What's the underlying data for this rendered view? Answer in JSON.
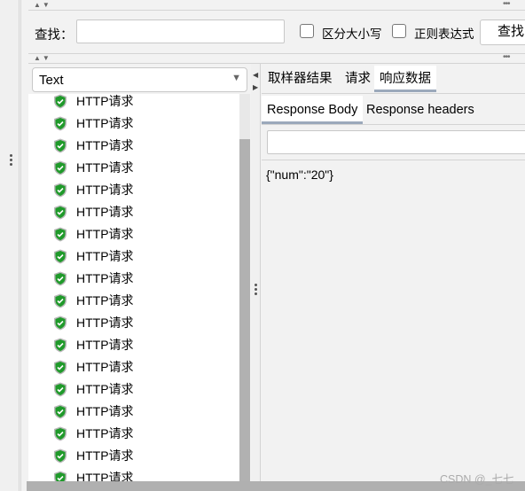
{
  "search": {
    "label": "查找：",
    "value": "",
    "case_label": "区分大小写",
    "regex_label": "正则表达式",
    "button": "查找"
  },
  "renderer": {
    "selected": "Text"
  },
  "tree": {
    "items": [
      "HTTP请求",
      "HTTP请求",
      "HTTP请求",
      "HTTP请求",
      "HTTP请求",
      "HTTP请求",
      "HTTP请求",
      "HTTP请求",
      "HTTP请求",
      "HTTP请求",
      "HTTP请求",
      "HTTP请求",
      "HTTP请求",
      "HTTP请求",
      "HTTP请求",
      "HTTP请求",
      "HTTP请求",
      "HTTP请求",
      "HTTP请求"
    ],
    "selected_index": 18,
    "status_icon": "green-shield-check-icon"
  },
  "tabs": [
    {
      "label": "取样器结果"
    },
    {
      "label": "请求"
    },
    {
      "label": "响应数据"
    }
  ],
  "active_tab": 2,
  "subtabs": [
    {
      "label": "Response Body"
    },
    {
      "label": "Response headers"
    }
  ],
  "response": {
    "filter_value": "",
    "body": "{\"num\":\"20\"}"
  },
  "watermark": "CSDN @_七七",
  "colors": {
    "selection": "#2a76c4",
    "tab_underline": "#9ba9bb",
    "shield": "#1f9a2a"
  }
}
